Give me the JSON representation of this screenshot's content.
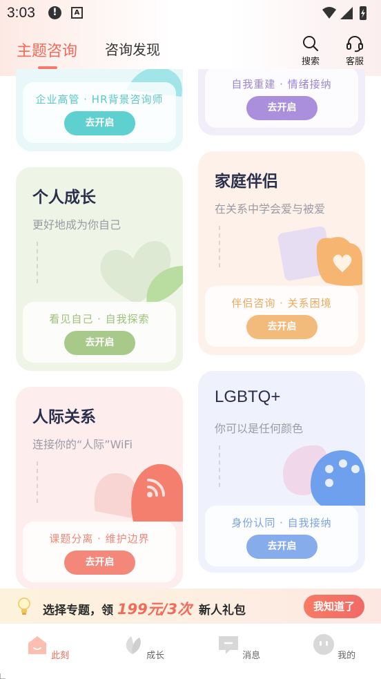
{
  "status": {
    "time": "3:03",
    "alert_glyph": "!",
    "a_glyph": "A"
  },
  "header": {
    "tab_active": "主题咨询",
    "tab_inactive": "咨询发现",
    "search_label": "搜索",
    "service_label": "客服"
  },
  "cards": {
    "career": {
      "tag": "企业高管 · HR背景咨询师",
      "button": "去开启",
      "accent": "#5fd0d0"
    },
    "self": {
      "tag": "自我重建 · 情绪接纳",
      "button": "去开启",
      "accent": "#a98fdc"
    },
    "growth": {
      "title": "个人成长",
      "subtitle": "更好地成为你自己",
      "tag": "看见自己 · 自我探索",
      "button": "去开启",
      "accent": "#a7c98a"
    },
    "family": {
      "title": "家庭伴侣",
      "subtitle": "在关系中学会爱与被爱",
      "tag": "伴侣咨询 · 关系困境",
      "button": "去开启",
      "accent": "#f2bb7c"
    },
    "social": {
      "title": "人际关系",
      "subtitle": "连接你的“人际”WiFi",
      "tag": "课题分离 · 维护边界",
      "button": "去开启",
      "accent": "#f3887a"
    },
    "lgbt": {
      "title": "LGBTQ+",
      "subtitle": "你可以是任何颜色",
      "tag": "身份认同 · 自我接纳",
      "button": "去开启",
      "accent": "#86acec"
    }
  },
  "banner": {
    "text_before": "选择专题，领",
    "price": "199元/3次",
    "text_after": "新人礼包",
    "button": "我知道了"
  },
  "tabbar": {
    "items": [
      {
        "label": "此刻",
        "icon": "home-icon"
      },
      {
        "label": "成长",
        "icon": "leaf-icon"
      },
      {
        "label": "消息",
        "icon": "message-icon"
      },
      {
        "label": "我的",
        "icon": "profile-icon"
      }
    ]
  },
  "colors": {
    "brand": "#f26a5a"
  }
}
